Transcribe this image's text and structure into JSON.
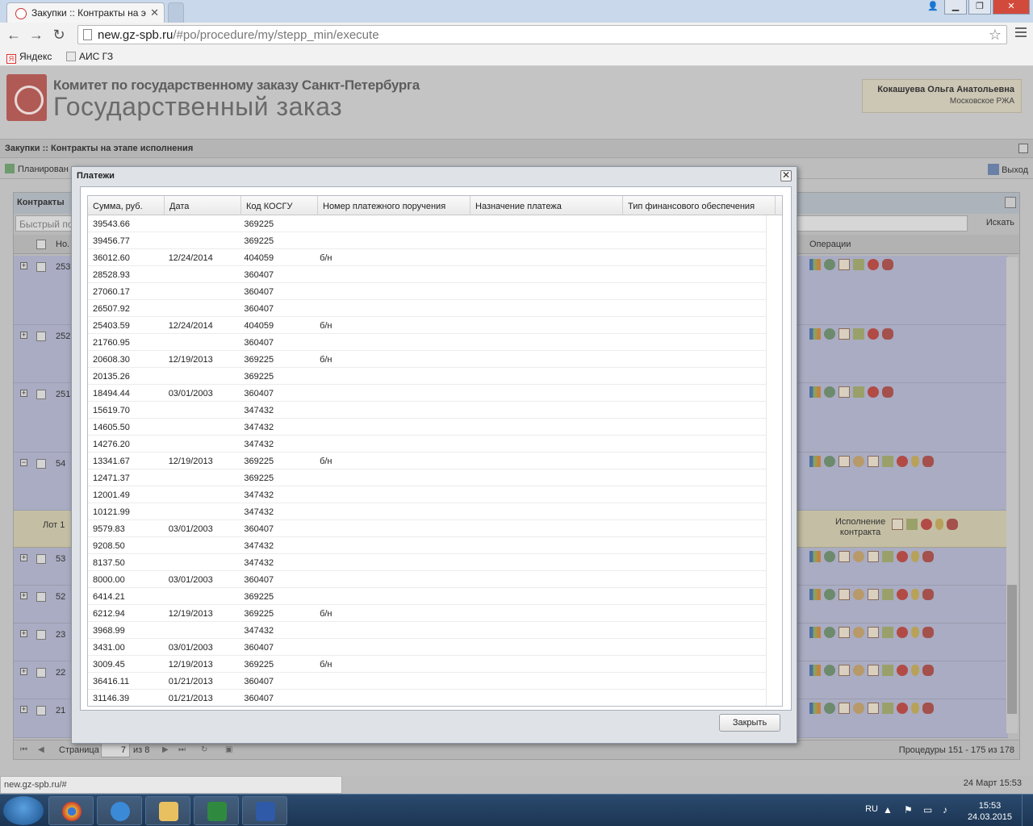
{
  "browser": {
    "tab_title": "Закупки :: Контракты на э",
    "url_host": "new.gz-spb.ru",
    "url_path": "/#po/procedure/my/stepp_min/execute",
    "bookmarks": [
      "Яндекс",
      "АИС ГЗ"
    ],
    "status_url": "new.gz-spb.ru/#"
  },
  "header": {
    "org_line1": "Комитет по государственному заказу Санкт-Петербурга",
    "org_line2": "Государственный заказ",
    "user_name": "Кокашуева Ольга Анатольевна",
    "user_org": "Московское РЖА"
  },
  "page": {
    "section_title": "Закупки :: Контракты на этапе исполнения",
    "plan_label": "Планирован",
    "exit_label": "Выход",
    "grid_title": "Контракты",
    "quicksearch_placeholder": "Быстрый по",
    "search_label": "Искать",
    "col_no": "Но.",
    "col_ops": "Операции",
    "rows": [
      {
        "num": "253"
      },
      {
        "num": "252"
      },
      {
        "num": "251"
      },
      {
        "num": "54"
      },
      {
        "num": "53"
      },
      {
        "num": "52"
      },
      {
        "num": "23"
      },
      {
        "num": "22"
      },
      {
        "num": "21"
      }
    ],
    "lot_label": "Лот 1",
    "lot_exec_line1": "Исполнение",
    "lot_exec_line2": "контракта",
    "pager_label": "Страница",
    "pager_value": "7",
    "pager_of": "из 8",
    "pager_range": "Процедуры 151 - 175 из 178",
    "status_date": "24 Март 15:53"
  },
  "modal": {
    "title": "Платежи",
    "close_label": "Закрыть",
    "columns": [
      "Сумма, руб.",
      "Дата",
      "Код КОСГУ",
      "Номер платежного поручения",
      "Назначение платежа",
      "Тип финансового обеспечения"
    ],
    "rows": [
      [
        "39543.66",
        "",
        "369225",
        "",
        "",
        ""
      ],
      [
        "39456.77",
        "",
        "369225",
        "",
        "",
        ""
      ],
      [
        "36012.60",
        "12/24/2014",
        "404059",
        "б/н",
        "",
        ""
      ],
      [
        "28528.93",
        "",
        "360407",
        "",
        "",
        ""
      ],
      [
        "27060.17",
        "",
        "360407",
        "",
        "",
        ""
      ],
      [
        "26507.92",
        "",
        "360407",
        "",
        "",
        ""
      ],
      [
        "25403.59",
        "12/24/2014",
        "404059",
        "б/н",
        "",
        ""
      ],
      [
        "21760.95",
        "",
        "360407",
        "",
        "",
        ""
      ],
      [
        "20608.30",
        "12/19/2013",
        "369225",
        "б/н",
        "",
        ""
      ],
      [
        "20135.26",
        "",
        "369225",
        "",
        "",
        ""
      ],
      [
        "18494.44",
        "03/01/2003",
        "360407",
        "",
        "",
        ""
      ],
      [
        "15619.70",
        "",
        "347432",
        "",
        "",
        ""
      ],
      [
        "14605.50",
        "",
        "347432",
        "",
        "",
        ""
      ],
      [
        "14276.20",
        "",
        "347432",
        "",
        "",
        ""
      ],
      [
        "13341.67",
        "12/19/2013",
        "369225",
        "б/н",
        "",
        ""
      ],
      [
        "12471.37",
        "",
        "369225",
        "",
        "",
        ""
      ],
      [
        "12001.49",
        "",
        "347432",
        "",
        "",
        ""
      ],
      [
        "10121.99",
        "",
        "347432",
        "",
        "",
        ""
      ],
      [
        "9579.83",
        "03/01/2003",
        "360407",
        "",
        "",
        ""
      ],
      [
        "9208.50",
        "",
        "347432",
        "",
        "",
        ""
      ],
      [
        "8137.50",
        "",
        "347432",
        "",
        "",
        ""
      ],
      [
        "8000.00",
        "03/01/2003",
        "360407",
        "",
        "",
        ""
      ],
      [
        "6414.21",
        "",
        "369225",
        "",
        "",
        ""
      ],
      [
        "6212.94",
        "12/19/2013",
        "369225",
        "б/н",
        "",
        ""
      ],
      [
        "3968.99",
        "",
        "347432",
        "",
        "",
        ""
      ],
      [
        "3431.00",
        "03/01/2003",
        "360407",
        "",
        "",
        ""
      ],
      [
        "3009.45",
        "12/19/2013",
        "369225",
        "б/н",
        "",
        ""
      ],
      [
        "36416.11",
        "01/21/2013",
        "360407",
        "",
        "",
        ""
      ],
      [
        "31146.39",
        "01/21/2013",
        "360407",
        "",
        "",
        ""
      ]
    ]
  },
  "taskbar": {
    "lang": "RU",
    "time": "15:53",
    "date": "24.03.2015"
  }
}
